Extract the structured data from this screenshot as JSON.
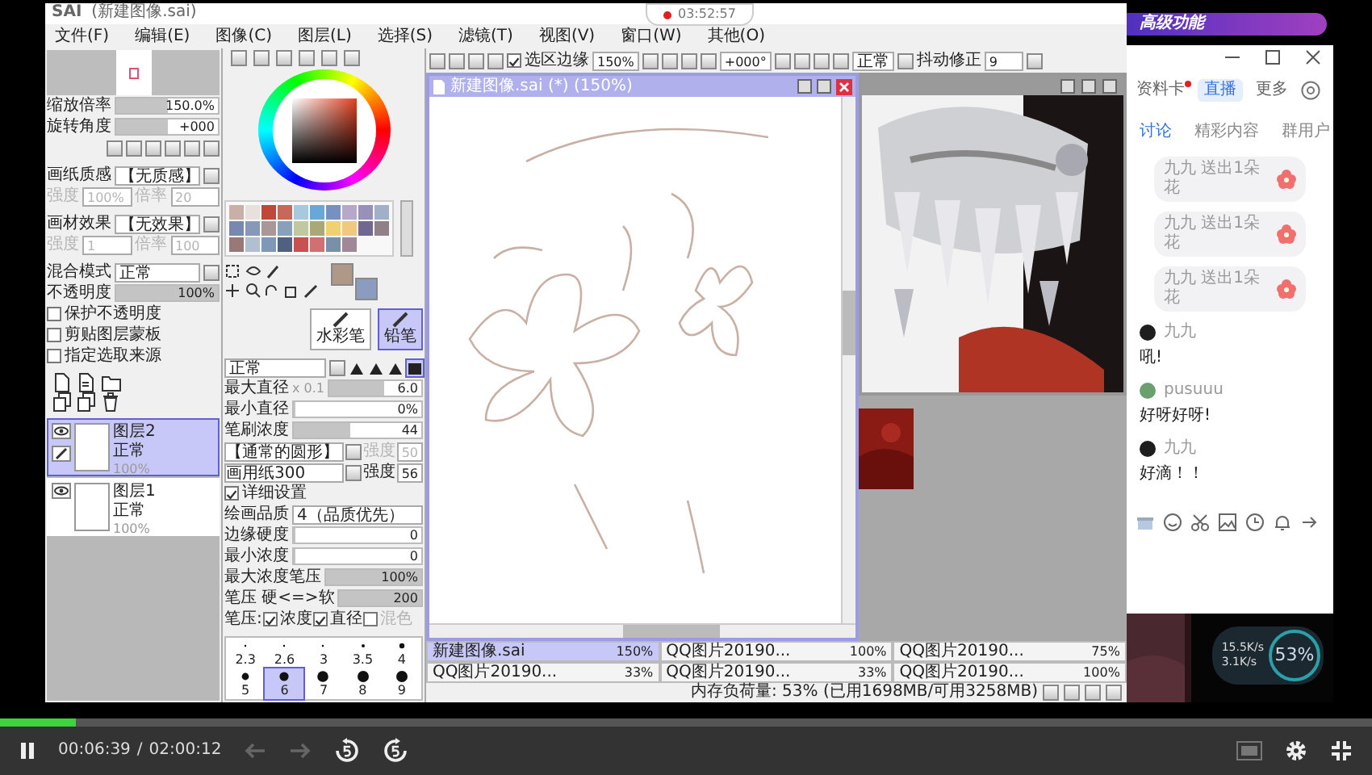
{
  "title_bar": {
    "app": "SAI",
    "document": "(新建图像.sai)"
  },
  "recording": {
    "time": "03:52:57"
  },
  "menu": [
    "文件(F)",
    "编辑(E)",
    "图像(C)",
    "图层(L)",
    "选择(S)",
    "滤镜(T)",
    "视图(V)",
    "窗口(W)",
    "其他(O)"
  ],
  "navigator": [
    {
      "label": "缩放倍率",
      "value": "150.0%",
      "level": 0.5
    },
    {
      "label": "旋转角度",
      "value": "+000",
      "level": 0.5
    }
  ],
  "paper": [
    {
      "label": "画纸质感",
      "value": "【无质感】",
      "params": [
        {
          "label": "强度",
          "value": "100%",
          "disabled": true
        },
        {
          "label": "倍率",
          "value": "20",
          "disabled": true
        }
      ]
    },
    {
      "label": "画材效果",
      "value": "【无效果】",
      "params": [
        {
          "label": "强度",
          "value": "1",
          "disabled": true
        },
        {
          "label": "倍率",
          "value": "100",
          "disabled": true
        }
      ]
    }
  ],
  "blend": {
    "label": "混合模式",
    "value": "正常"
  },
  "opacity": {
    "label": "不透明度",
    "value": "100%",
    "level": 1
  },
  "layer_options": [
    {
      "label": "保护不透明度",
      "checked": false
    },
    {
      "label": "剪贴图层蒙板",
      "checked": false
    },
    {
      "label": "指定选取来源",
      "checked": false
    }
  ],
  "layers": [
    {
      "name": "图层2",
      "mode": "正常",
      "opacity": "100%",
      "selected": true
    },
    {
      "name": "图层1",
      "mode": "正常",
      "opacity": "100%",
      "selected": false
    }
  ],
  "palette": [
    {
      "color": "#c8b0a8"
    },
    {
      "color": "#e8e0dc"
    },
    {
      "color": "#c04838"
    },
    {
      "color": "#c86858"
    },
    {
      "color": "#a8c8dc"
    },
    {
      "color": "#68a8d8"
    },
    {
      "color": "#7890c0"
    },
    {
      "color": "#b8a8c8"
    },
    {
      "color": "#9890b8"
    },
    {
      "color": "#a0b0c8"
    },
    {
      "color": "#7888b0"
    },
    {
      "color": "#8898b8"
    },
    {
      "color": "#a89898"
    },
    {
      "color": "#88a0b8"
    },
    {
      "color": "#c0c8a0"
    },
    {
      "color": "#a8a878"
    },
    {
      "color": "#f0d070"
    },
    {
      "color": "#f0c880"
    },
    {
      "color": "#706890"
    },
    {
      "color": "#908088"
    },
    {
      "color": "#987878"
    },
    {
      "color": "#b0c0d0"
    },
    {
      "color": "#8098b8"
    },
    {
      "color": "#506080"
    },
    {
      "color": "#c85050"
    },
    {
      "color": "#d07070"
    },
    {
      "color": "#7890a8"
    },
    {
      "color": "#a08898"
    }
  ],
  "current_colors": [
    {
      "color": "#b09888"
    },
    {
      "color": "#8c9cc0"
    }
  ],
  "tools": [
    {
      "label": "水彩笔",
      "selected": false
    },
    {
      "label": "铅笔",
      "selected": true
    }
  ],
  "brush": {
    "mode": "正常",
    "shapes": [
      {
        "selected": false
      },
      {
        "selected": false
      },
      {
        "selected": false
      },
      {
        "selected": true
      }
    ],
    "sliders": [
      {
        "label": "最大直径",
        "multiplier": "x 0.1",
        "value": "6.0",
        "level": 0.6
      },
      {
        "label": "最小直径",
        "value": "0%",
        "level": 0
      },
      {
        "label": "笔刷浓度",
        "value": "44",
        "level": 0.44
      }
    ],
    "shape": {
      "value": "【通常的圆形】",
      "strength_label": "强度",
      "strength": "50",
      "disabled": true
    },
    "texture": {
      "value": "画用纸300",
      "strength_label": "强度",
      "strength": "56",
      "disabled": false
    },
    "advanced": {
      "label": "详细设置",
      "checked": true
    },
    "quality": {
      "label": "绘画品质",
      "value": "4（品质优先）"
    },
    "detail_sliders": [
      {
        "label": "边缘硬度",
        "value": "0",
        "level": 0
      },
      {
        "label": "最小浓度",
        "value": "0",
        "level": 0
      },
      {
        "label": "最大浓度笔压",
        "value": "100%",
        "level": 1
      },
      {
        "label": "笔压 硬<=>软",
        "value": "200",
        "level": 1
      }
    ],
    "pressure_label": "笔压:",
    "pressure_options": [
      {
        "label": "浓度",
        "checked": true
      },
      {
        "label": "直径",
        "checked": true
      },
      {
        "label": "混色",
        "checked": false
      }
    ]
  },
  "brush_sizes": [
    {
      "label": "2.3",
      "selected": false
    },
    {
      "label": "2.6",
      "selected": false
    },
    {
      "label": "3",
      "selected": false
    },
    {
      "label": "3.5",
      "selected": false
    },
    {
      "label": "4",
      "selected": false
    },
    {
      "label": "5",
      "selected": false
    },
    {
      "label": "6",
      "selected": true
    },
    {
      "label": "7",
      "selected": false
    },
    {
      "label": "8",
      "selected": false
    },
    {
      "label": "9",
      "selected": false
    }
  ],
  "toolbar": {
    "select_edge": {
      "label": "选区边缘",
      "checked": true
    },
    "zoom": "150%",
    "angle": "+000°",
    "mode": "正常",
    "stabilizer_label": "抖动修正",
    "stabilizer": "9"
  },
  "canvas_window": {
    "title": "新建图像.sai (*) (150%)"
  },
  "doc_tabs": [
    {
      "name": "新建图像.sai",
      "zoom": "150%",
      "selected": true
    },
    {
      "name": "QQ图片20190...",
      "zoom": "100%",
      "selected": false
    },
    {
      "name": "QQ图片20190...",
      "zoom": "75%",
      "selected": false
    },
    {
      "name": "QQ图片20190...",
      "zoom": "33%",
      "selected": false
    },
    {
      "name": "QQ图片20190...",
      "zoom": "33%",
      "selected": false
    },
    {
      "name": "QQ图片20190...",
      "zoom": "100%",
      "selected": false
    }
  ],
  "status": "内存负荷量: 53% (已用1698MB/可用3258MB)",
  "chat": {
    "banner": "高级功能",
    "nav": [
      {
        "label": "资料卡",
        "selected": false,
        "unread": true
      },
      {
        "label": "直播",
        "selected": true,
        "unread": false
      },
      {
        "label": "更多",
        "selected": false,
        "unread": false
      }
    ],
    "tabs": [
      {
        "label": "讨论",
        "selected": true
      },
      {
        "label": "精彩内容",
        "selected": false
      },
      {
        "label": "群用户",
        "selected": false
      }
    ],
    "gifts": [
      {
        "text": "九九 送出1朵花"
      },
      {
        "text": "九九 送出1朵花"
      },
      {
        "text": "九九 送出1朵花"
      }
    ],
    "messages": [
      {
        "user": "九九",
        "color": "#1e1e1e",
        "text": "吼!"
      },
      {
        "user": "pusuuu",
        "color": "#6aa070",
        "text": "好呀好呀!"
      },
      {
        "user": "九九",
        "color": "#1e1e1e",
        "text": "好滴！！"
      }
    ],
    "net": {
      "up": "15.5K/s",
      "down": "3.1K/s",
      "percent": "53%"
    }
  },
  "player": {
    "level": 0.055,
    "current": "00:06:39",
    "separator": "/",
    "total": "02:00:12"
  }
}
